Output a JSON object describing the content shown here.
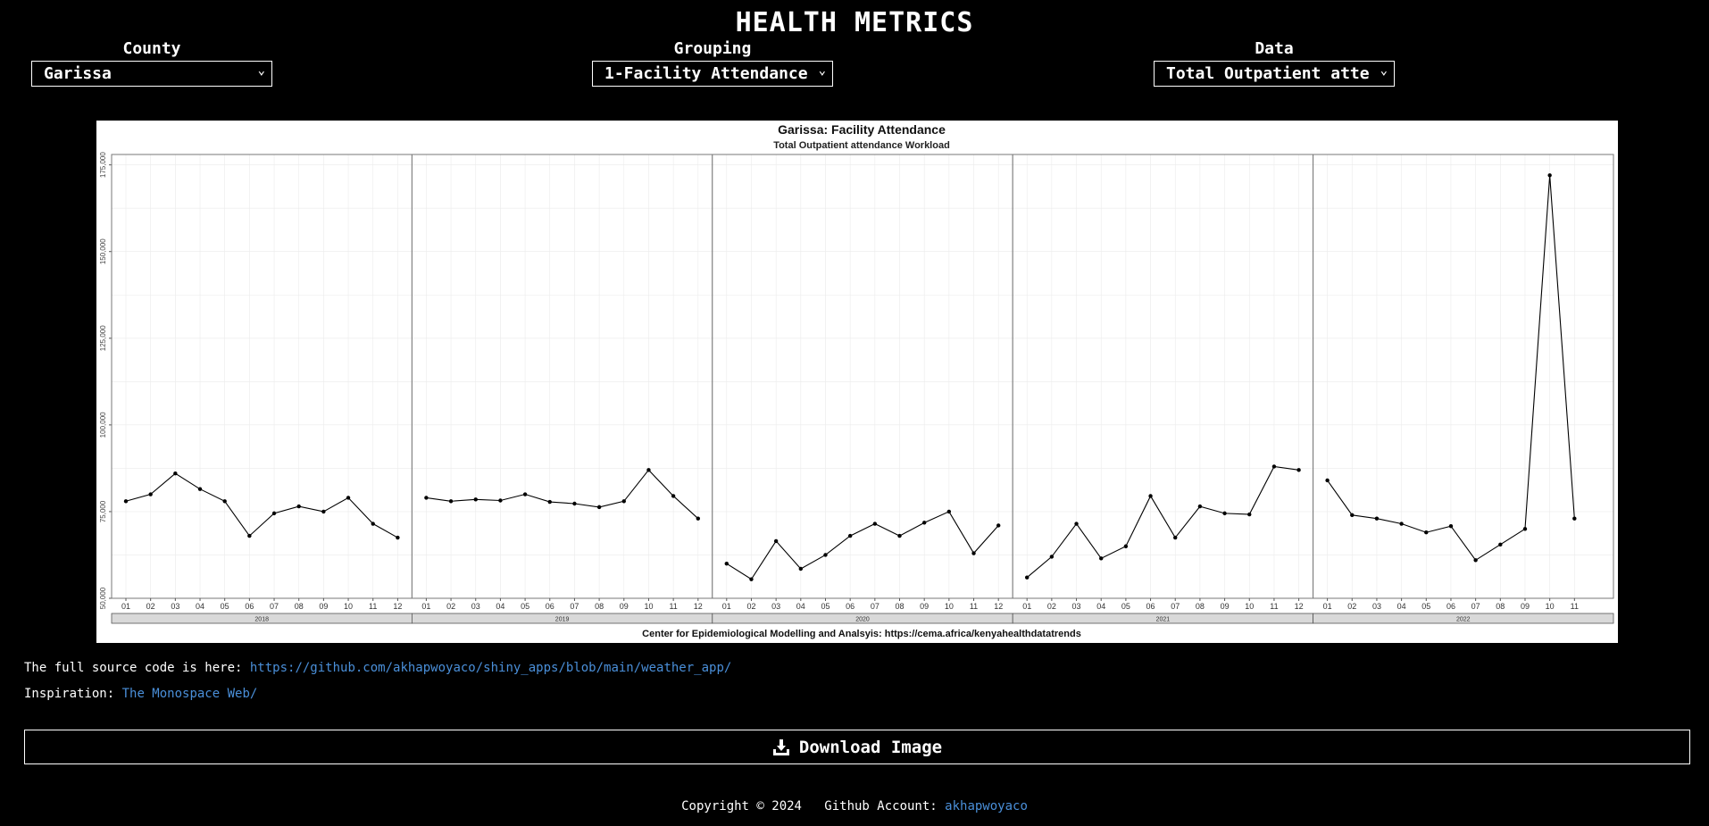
{
  "header": {
    "title": "HEALTH METRICS"
  },
  "controls": {
    "county": {
      "label": "County",
      "value": "Garissa"
    },
    "grouping": {
      "label": "Grouping",
      "value": "1-Facility Attendance"
    },
    "data": {
      "label": "Data",
      "value": "Total Outpatient atte"
    }
  },
  "chart_data": {
    "type": "line",
    "title": "Garissa: Facility Attendance",
    "subtitle": "Total Outpatient attendance Workload",
    "caption": "Center for Epidemiological Modelling and Analsyis: https://cema.africa/kenyahealthdatatrends",
    "ylim": [
      50000,
      178000
    ],
    "yticks": [
      50000,
      75000,
      100000,
      125000,
      150000,
      175000
    ],
    "ytick_labels": [
      "50,000",
      "75,000",
      "100,000",
      "125,000",
      "150,000",
      "175,000"
    ],
    "grid": true,
    "series_color": "#000000",
    "panels": [
      {
        "year": "2018",
        "months": [
          "01",
          "02",
          "03",
          "04",
          "05",
          "06",
          "07",
          "08",
          "09",
          "10",
          "11",
          "12"
        ],
        "values": [
          78000,
          80000,
          86000,
          81500,
          78000,
          68000,
          74500,
          76500,
          75000,
          79000,
          71500,
          67500
        ]
      },
      {
        "year": "2019",
        "months": [
          "01",
          "02",
          "03",
          "04",
          "05",
          "06",
          "07",
          "08",
          "09",
          "10",
          "11",
          "12"
        ],
        "values": [
          79000,
          78000,
          78500,
          78200,
          80000,
          77800,
          77300,
          76300,
          78000,
          87000,
          79500,
          73000
        ]
      },
      {
        "year": "2020",
        "months": [
          "01",
          "02",
          "03",
          "04",
          "05",
          "06",
          "07",
          "08",
          "09",
          "10",
          "11",
          "12"
        ],
        "values": [
          60000,
          55500,
          66500,
          58500,
          62500,
          68000,
          71500,
          68000,
          71800,
          75000,
          63000,
          71000
        ]
      },
      {
        "year": "2021",
        "months": [
          "01",
          "02",
          "03",
          "04",
          "05",
          "06",
          "07",
          "08",
          "09",
          "10",
          "11",
          "12"
        ],
        "values": [
          56000,
          62000,
          71500,
          61500,
          65000,
          79500,
          67500,
          76500,
          74500,
          74200,
          88000,
          87000
        ]
      },
      {
        "year": "2022",
        "months": [
          "01",
          "02",
          "03",
          "04",
          "05",
          "06",
          "07",
          "08",
          "09",
          "10",
          "11"
        ],
        "values": [
          84000,
          74000,
          73000,
          71500,
          69000,
          70800,
          61000,
          65500,
          70000,
          172000,
          73000
        ]
      }
    ]
  },
  "links": {
    "source_prefix": "The full source code is here:",
    "source_url": "https://github.com/akhapwoyaco/shiny_apps/blob/main/weather_app/",
    "inspiration_prefix": "Inspiration:",
    "inspiration_text": "The Monospace Web/"
  },
  "download": {
    "label": "Download Image",
    "icon": "download-icon"
  },
  "footer": {
    "copyright": "Copyright © 2024",
    "github_prefix": "Github Account:",
    "github_user": "akhapwoyaco"
  }
}
